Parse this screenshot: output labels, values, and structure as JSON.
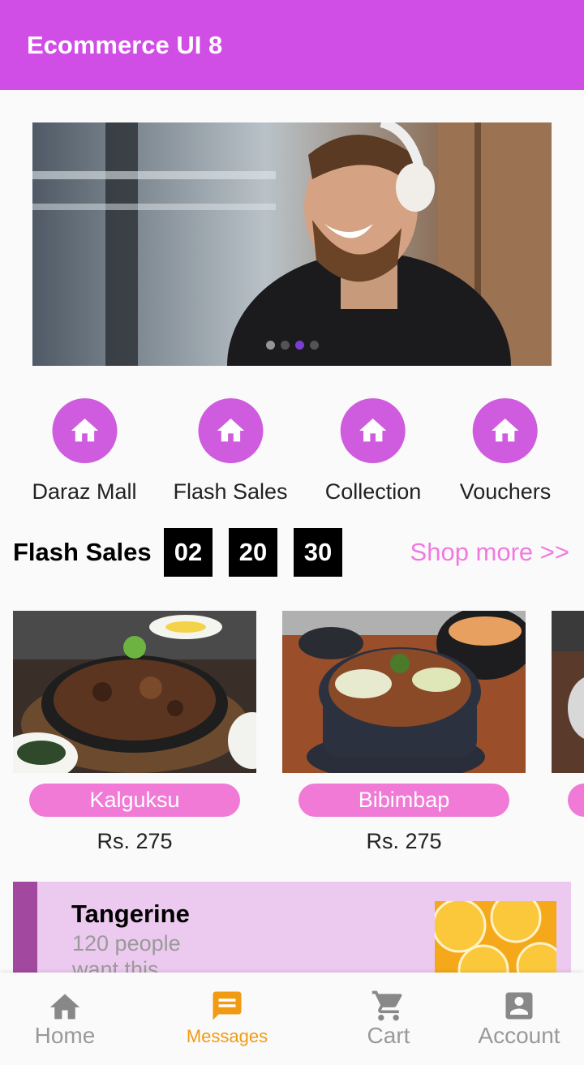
{
  "app_bar": {
    "title": "Ecommerce UI 8",
    "color": "#d04de6"
  },
  "banner": {
    "slide_count": 4,
    "active_index": 2
  },
  "categories": [
    {
      "label": "Daraz Mall",
      "icon": "home-icon"
    },
    {
      "label": "Flash Sales",
      "icon": "home-icon"
    },
    {
      "label": "Collection",
      "icon": "home-icon"
    },
    {
      "label": "Vouchers",
      "icon": "home-icon"
    }
  ],
  "flash_sales": {
    "title": "Flash Sales",
    "timer": {
      "hours": "02",
      "minutes": "20",
      "seconds": "30"
    },
    "shop_more": "Shop more >>"
  },
  "products": [
    {
      "name": "Kalguksu",
      "price": "Rs. 275"
    },
    {
      "name": "Bibimbap",
      "price": "Rs. 275"
    }
  ],
  "deal_card": {
    "name": "Tangerine",
    "subtitle": "120 people want this"
  },
  "bottom_nav": [
    {
      "label": "Home",
      "icon": "home-icon",
      "active": false
    },
    {
      "label": "Messages",
      "icon": "message-icon",
      "active": true
    },
    {
      "label": "Cart",
      "icon": "cart-icon",
      "active": false
    },
    {
      "label": "Account",
      "icon": "account-icon",
      "active": false
    }
  ],
  "colors": {
    "accent": "#d04de6",
    "pill": "#f07ad6",
    "active_nav": "#f19a13"
  }
}
